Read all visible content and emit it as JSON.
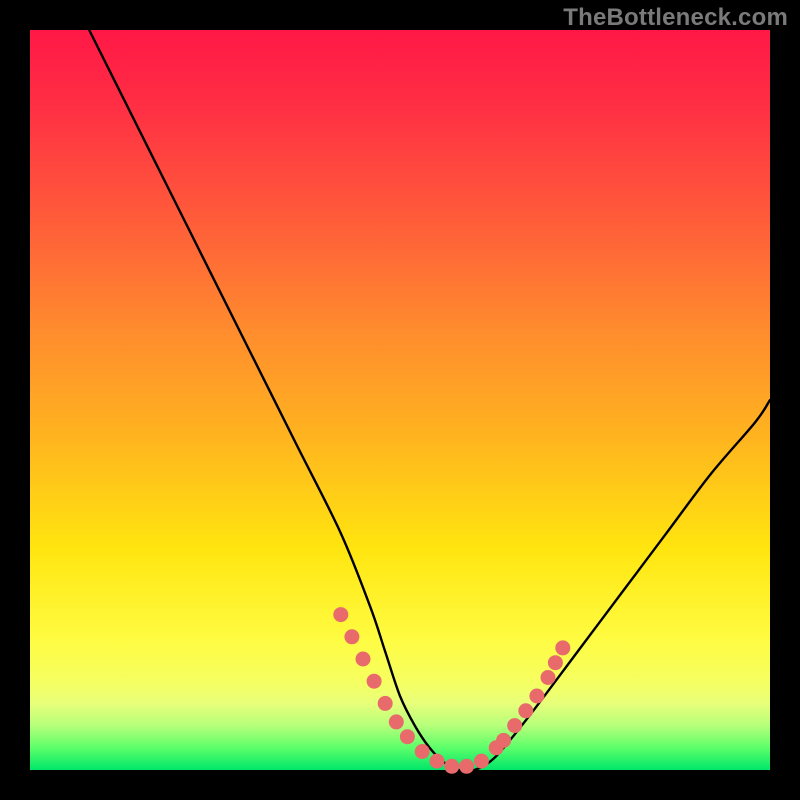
{
  "watermark": "TheBottleneck.com",
  "chart_data": {
    "type": "line",
    "title": "",
    "xlabel": "",
    "ylabel": "",
    "xlim": [
      0,
      100
    ],
    "ylim": [
      0,
      100
    ],
    "grid": false,
    "legend": false,
    "series": [
      {
        "name": "bottleneck-curve",
        "x": [
          8,
          12,
          18,
          24,
          30,
          36,
          42,
          46,
          48,
          50,
          52,
          54,
          56,
          58,
          60,
          62,
          64,
          68,
          74,
          80,
          86,
          92,
          98,
          100
        ],
        "values": [
          100,
          92,
          80,
          68,
          56,
          44,
          32,
          22,
          16,
          10,
          6,
          3,
          1,
          0,
          0,
          1,
          3,
          8,
          16,
          24,
          32,
          40,
          47,
          50
        ]
      }
    ],
    "scatter_points": {
      "name": "highlight-dots",
      "color": "#e86a6a",
      "x": [
        42,
        43.5,
        45,
        46.5,
        48,
        49.5,
        51,
        53,
        55,
        57,
        59,
        61,
        63,
        64,
        65.5,
        67,
        68.5,
        70,
        71,
        72
      ],
      "values": [
        21,
        18,
        15,
        12,
        9,
        6.5,
        4.5,
        2.5,
        1.2,
        0.5,
        0.5,
        1.2,
        3,
        4,
        6,
        8,
        10,
        12.5,
        14.5,
        16.5
      ]
    }
  }
}
